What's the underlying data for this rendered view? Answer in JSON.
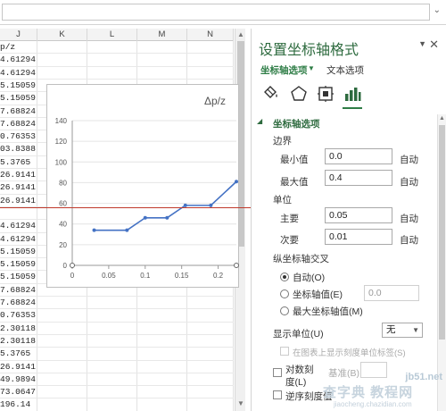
{
  "sheet": {
    "columns": [
      "J",
      "K",
      "L",
      "M",
      "N"
    ],
    "rows": [
      "p/z",
      "4.61294",
      "4.61294",
      "5.15059",
      "5.15059",
      "7.68824",
      "7.68824",
      "0.76353",
      "03.8388",
      "5.3765",
      "26.9141",
      "26.9141",
      "26.9141",
      "",
      "4.61294",
      "4.61294",
      "5.15059",
      "5.15059",
      "5.15059",
      "7.68824",
      "7.68824",
      "0.76353",
      "2.30118",
      "2.30118",
      "5.3765",
      "26.9141",
      "49.9894",
      "73.0647",
      "196.14"
    ]
  },
  "chart": {
    "legend_label": "Δp/z"
  },
  "chart_data": {
    "type": "line",
    "title": "",
    "legend": "Δp/z",
    "x_ticks": [
      "0",
      "0.05",
      "0.1",
      "0.15",
      "0.2"
    ],
    "y_ticks": [
      "0",
      "20",
      "40",
      "60",
      "80",
      "100",
      "120",
      "140"
    ],
    "xlim": [
      0,
      0.225
    ],
    "ylim": [
      0,
      140
    ],
    "series": [
      {
        "name": "Δp/z",
        "x": [
          0.03,
          0.075,
          0.1,
          0.13,
          0.155,
          0.19,
          0.225
        ],
        "y": [
          34,
          34,
          46,
          46,
          58,
          58,
          81
        ]
      }
    ]
  },
  "pane": {
    "title": "设置坐标轴格式",
    "tab_axis": "坐标轴选项",
    "tab_text": "文本选项",
    "section": "坐标轴选项",
    "bounds": {
      "label": "边界",
      "min_label": "最小值",
      "min_value": "0.0",
      "max_label": "最大值",
      "max_value": "0.4",
      "auto": "自动"
    },
    "units": {
      "label": "单位",
      "major_label": "主要",
      "major_value": "0.05",
      "minor_label": "次要",
      "minor_value": "0.01",
      "auto": "自动"
    },
    "cross": {
      "label": "纵坐标轴交叉",
      "auto": "自动(O)",
      "axis_value": "坐标轴值(E)",
      "axis_value_field": "0.0",
      "max": "最大坐标轴值(M)"
    },
    "display_units": {
      "label": "显示单位(U)",
      "value": "无",
      "show_label": "在图表上显示刻度单位标签(S)"
    },
    "log": {
      "label": "对数刻",
      "label2": "度(L)",
      "base": "基准(B)"
    },
    "reverse": {
      "label": "逆序刻度值"
    }
  },
  "watermark": {
    "line1": "jb51.net",
    "line2": "查字典 教程网",
    "line3": "jiaocheng.chazidian.com"
  }
}
